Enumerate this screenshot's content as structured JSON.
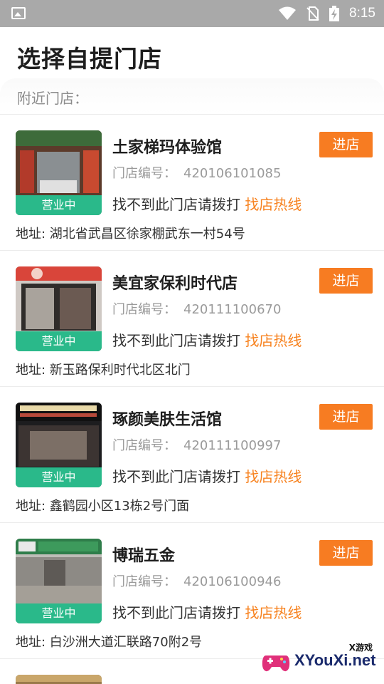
{
  "statusbar": {
    "time": "8:15"
  },
  "header": {
    "title": "选择自提门店"
  },
  "nearby": {
    "label": "附近门店："
  },
  "common": {
    "code_label": "门店编号：",
    "hint_text": "找不到此门店请拨打",
    "hotline_text": "找店热线",
    "enter_label": "进店",
    "status_label": "营业中"
  },
  "stores": [
    {
      "name": "土家梯玛体验馆",
      "code": "420106101085",
      "address": "地址: 湖北省武昌区徐家棚武东一村54号"
    },
    {
      "name": "美宜家保利时代店",
      "code": "420111100670",
      "address": "地址: 新玉路保利时代北区北门"
    },
    {
      "name": "琢颜美肤生活馆",
      "code": "420111100997",
      "address": "地址: 鑫鹤园小区13栋2号门面"
    },
    {
      "name": "博瑞五金",
      "code": "420106100946",
      "address": "地址: 白沙洲大道汇联路70附2号"
    }
  ],
  "watermark": {
    "main": "XYouXi.net",
    "sub": "X游戏"
  },
  "colors": {
    "accent": "#f77c22",
    "status_green": "#2ab98a",
    "hotline": "#f7821f"
  }
}
